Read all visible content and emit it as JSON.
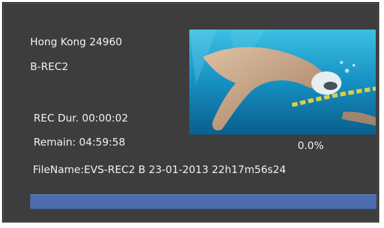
{
  "recorder": {
    "location": "Hong Kong  24960",
    "channel": "B-REC2",
    "rec_duration": "REC Dur. 00:00:02",
    "remain": "Remain:  04:59:58",
    "progress_text": "0.0%",
    "file_name": "FileName:EVS-REC2 B 23-01-2013 22h17m56s24",
    "progress_value": 1.0
  },
  "preview": {
    "subject": "swimmer-underwater-thumbnail"
  },
  "colors": {
    "panel_bg": "#3d3d3d",
    "text": "#f2f2f2",
    "progress_bar": "#4c6caf"
  }
}
